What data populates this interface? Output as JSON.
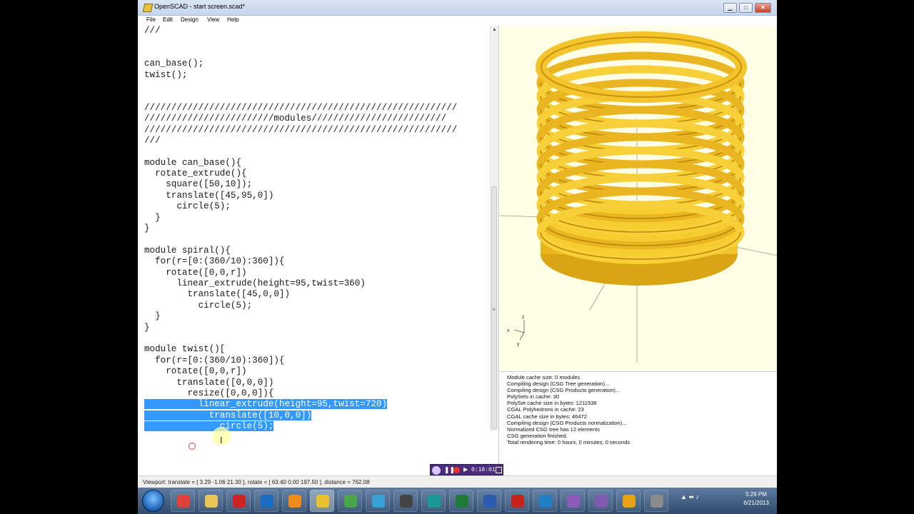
{
  "window": {
    "title": "OpenSCAD - start screen.scad*",
    "min_glyph": "▁",
    "max_glyph": "□",
    "close_glyph": "✕"
  },
  "menu": [
    "File",
    "Edit",
    "View",
    "Help"
  ],
  "editor": {
    "lines": [
      {
        "text": "///",
        "sel": false
      },
      {
        "text": "",
        "sel": false
      },
      {
        "text": "",
        "sel": false
      },
      {
        "text": "can_base();",
        "sel": false
      },
      {
        "text": "twist();",
        "sel": false
      },
      {
        "text": "",
        "sel": false
      },
      {
        "text": "",
        "sel": false
      },
      {
        "text": "//////////////////////////////////////////////////////////",
        "sel": false
      },
      {
        "text": "////////////////////////modules/////////////////////////",
        "sel": false
      },
      {
        "text": "//////////////////////////////////////////////////////////",
        "sel": false
      },
      {
        "text": "///",
        "sel": false
      },
      {
        "text": "",
        "sel": false
      },
      {
        "text": "module can_base(){",
        "sel": false
      },
      {
        "text": "  rotate_extrude(){",
        "sel": false
      },
      {
        "text": "    square([50,10]);",
        "sel": false
      },
      {
        "text": "    translate([45,95,0])",
        "sel": false
      },
      {
        "text": "      circle(5);",
        "sel": false
      },
      {
        "text": "  }",
        "sel": false
      },
      {
        "text": "}",
        "sel": false
      },
      {
        "text": "",
        "sel": false
      },
      {
        "text": "module spiral(){",
        "sel": false
      },
      {
        "text": "  for(r=[0:(360/10):360]){",
        "sel": false
      },
      {
        "text": "    rotate([0,0,r])",
        "sel": false
      },
      {
        "text": "      linear_extrude(height=95,twist=360)",
        "sel": false
      },
      {
        "text": "        translate([45,0,0])",
        "sel": false
      },
      {
        "text": "          circle(5);",
        "sel": false
      },
      {
        "text": "  }",
        "sel": false
      },
      {
        "text": "}",
        "sel": false
      },
      {
        "text": "",
        "sel": false
      },
      {
        "text": "module twist()[",
        "sel": false
      },
      {
        "text": "  for(r=[0:(360/10):360]){",
        "sel": false
      },
      {
        "text": "    rotate([0,0,r])",
        "sel": false
      },
      {
        "text": "      translate([0,0,0])",
        "sel": false
      },
      {
        "text": "        resize([0,0,0]){",
        "sel": false
      },
      {
        "text": "          linear_extrude(height=95,twist=720)",
        "sel": true
      },
      {
        "text": "            translate([10,0,0])",
        "sel": true
      },
      {
        "text": "              circle(5);",
        "sel": true
      }
    ]
  },
  "axes_labels": {
    "z": "z",
    "x": "x",
    "y": "y"
  },
  "console": [
    "Module cache size: 0 modules",
    "Compiling design (CSG Tree generation)...",
    "Compiling design (CSG Products generation)...",
    "PolySets in cache: 30",
    "PolySet cache size in bytes: 1211536",
    "CGAL Polyhedrons in cache: 23",
    "CGAL cache size in bytes: 46472",
    "Compiling design (CSG Products normalization)...",
    "Normalized CSG tree has 12 elements",
    "CSG generation finished.",
    "Total rendering time: 0 hours, 0 minutes, 0 seconds"
  ],
  "status": "Viewport: translate = [ 3.29 -1.06 21.30 ], rotate = [ 63.40 0.00 197.50 ], distance = 762.08",
  "recorder": {
    "time": "0:18:01"
  },
  "taskbar": {
    "apps": [
      "chrome",
      "explorer",
      "r",
      "ccleaner",
      "blender",
      "openscad",
      "sheet",
      "cf",
      "unity",
      "arduino",
      "excel",
      "word",
      "acrobat",
      "teamviewer",
      "gauge",
      "gauge2",
      "headphones",
      "misc"
    ],
    "tray_glyphs": "▲ ⬌ ♪",
    "time": "5:29 PM",
    "date": "6/21/2013"
  },
  "colors": {
    "accent": "#3399ff",
    "model": "#ffd43b",
    "viewport_bg": "#ffffe5"
  }
}
